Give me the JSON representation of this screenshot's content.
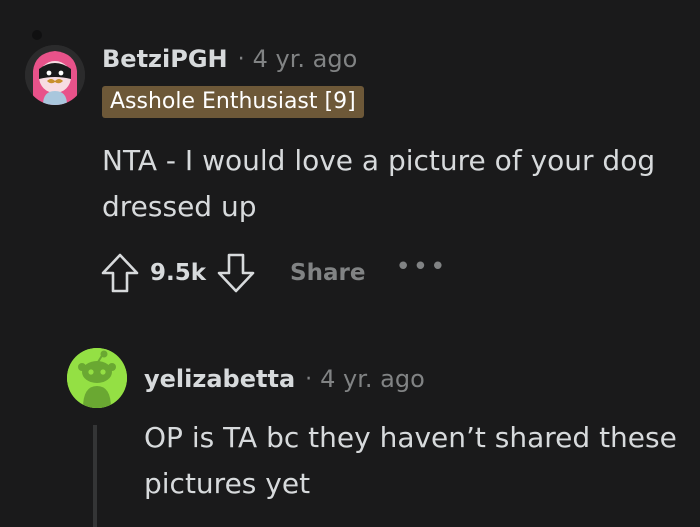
{
  "comment": {
    "username": "BetziPGH",
    "separator": "·",
    "timestamp": "4 yr. ago",
    "flair": "Asshole Enthusiast [9]",
    "text_line1": "NTA - I would love a picture of your dog",
    "text_line2": "dressed up",
    "votes": "9.5k",
    "share_label": "Share",
    "more_label": "•••"
  },
  "reply": {
    "username": "yelizabetta",
    "separator": "·",
    "timestamp": "4 yr. ago",
    "text_line1": "OP is TA bc they haven’t shared these",
    "text_line2": "pictures yet"
  },
  "colors": {
    "background": "#1a1a1b",
    "text": "#d7dadc",
    "muted": "#818384",
    "flair_bg": "#6d5838",
    "avatar2_bg": "#94e044",
    "avatar1_hair": "#e8528a"
  },
  "icons": {
    "upvote": "upvote-arrow-icon",
    "downvote": "downvote-arrow-icon",
    "more": "more-options-icon"
  }
}
